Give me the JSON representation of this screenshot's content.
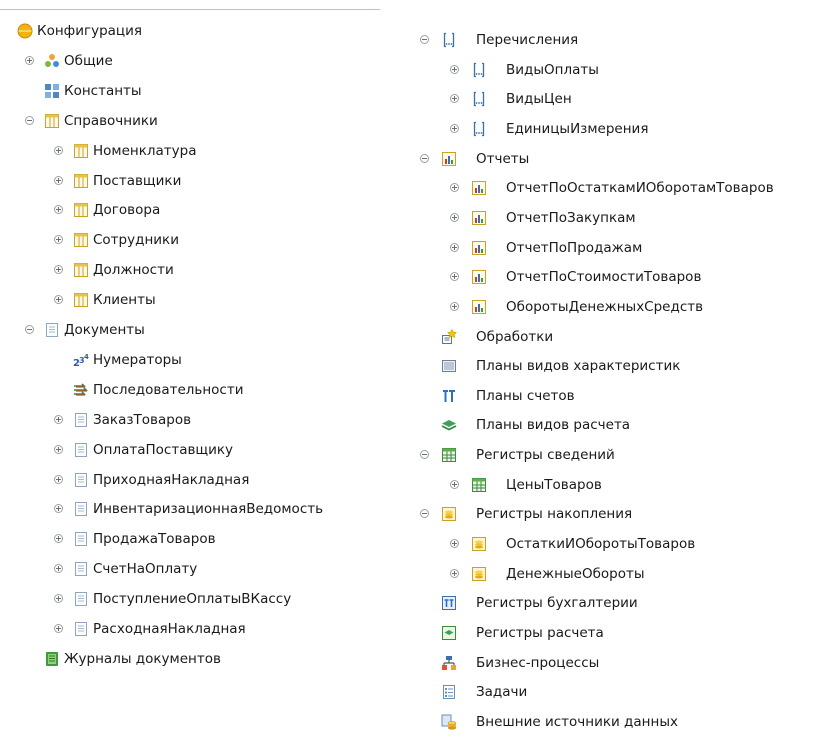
{
  "tree": {
    "left": [
      {
        "label": "Конфигурация",
        "icon": "configuration-icon",
        "toggle": "none",
        "level": 0
      },
      {
        "label": "Общие",
        "icon": "common-icon",
        "toggle": "plus",
        "level": 0
      },
      {
        "label": "Константы",
        "icon": "constants-icon",
        "toggle": "none",
        "level": 0
      },
      {
        "label": "Справочники",
        "icon": "catalog-icon",
        "toggle": "minus",
        "level": 0
      },
      {
        "label": "Номенклатура",
        "icon": "catalog-icon",
        "toggle": "plus",
        "level": 1
      },
      {
        "label": "Поставщики",
        "icon": "catalog-icon",
        "toggle": "plus",
        "level": 1
      },
      {
        "label": "Договора",
        "icon": "catalog-icon",
        "toggle": "plus",
        "level": 1
      },
      {
        "label": "Сотрудники",
        "icon": "catalog-icon",
        "toggle": "plus",
        "level": 1
      },
      {
        "label": "Должности",
        "icon": "catalog-icon",
        "toggle": "plus",
        "level": 1
      },
      {
        "label": "Клиенты",
        "icon": "catalog-icon",
        "toggle": "plus",
        "level": 1
      },
      {
        "label": "Документы",
        "icon": "document-icon",
        "toggle": "minus",
        "level": 0
      },
      {
        "label": "Нумераторы",
        "icon": "numerator-icon",
        "toggle": "none",
        "level": 1
      },
      {
        "label": "Последовательности",
        "icon": "sequence-icon",
        "toggle": "none",
        "level": 1
      },
      {
        "label": "ЗаказТоваров",
        "icon": "document-icon",
        "toggle": "plus",
        "level": 1
      },
      {
        "label": "ОплатаПоставщику",
        "icon": "document-icon",
        "toggle": "plus",
        "level": 1
      },
      {
        "label": "ПриходнаяНакладная",
        "icon": "document-icon",
        "toggle": "plus",
        "level": 1
      },
      {
        "label": "ИнвентаризационнаяВедомость",
        "icon": "document-icon",
        "toggle": "plus",
        "level": 1
      },
      {
        "label": "ПродажаТоваров",
        "icon": "document-icon",
        "toggle": "plus",
        "level": 1
      },
      {
        "label": "СчетНаОплату",
        "icon": "document-icon",
        "toggle": "plus",
        "level": 1
      },
      {
        "label": "ПоступлениеОплатыВКассу",
        "icon": "document-icon",
        "toggle": "plus",
        "level": 1
      },
      {
        "label": "РасходнаяНакладная",
        "icon": "document-icon",
        "toggle": "plus",
        "level": 1
      },
      {
        "label": "Журналы документов",
        "icon": "journal-icon",
        "toggle": "none",
        "level": 0
      }
    ],
    "right": [
      {
        "label": "Перечисления",
        "icon": "enum-icon",
        "toggle": "minus",
        "level": 0
      },
      {
        "label": "ВидыОплаты",
        "icon": "enum-icon",
        "toggle": "plus",
        "level": 1
      },
      {
        "label": "ВидыЦен",
        "icon": "enum-icon",
        "toggle": "plus",
        "level": 1
      },
      {
        "label": "ЕдиницыИзмерения",
        "icon": "enum-icon",
        "toggle": "plus",
        "level": 1
      },
      {
        "label": "Отчеты",
        "icon": "report-icon",
        "toggle": "minus",
        "level": 0
      },
      {
        "label": "ОтчетПоОстаткамИОборотамТоваров",
        "icon": "report-icon",
        "toggle": "plus",
        "level": 1
      },
      {
        "label": "ОтчетПоЗакупкам",
        "icon": "report-icon",
        "toggle": "plus",
        "level": 1
      },
      {
        "label": "ОтчетПоПродажам",
        "icon": "report-icon",
        "toggle": "plus",
        "level": 1
      },
      {
        "label": "ОтчетПоСтоимостиТоваров",
        "icon": "report-icon",
        "toggle": "plus",
        "level": 1
      },
      {
        "label": "ОборотыДенежныхСредств",
        "icon": "report-icon",
        "toggle": "plus",
        "level": 1
      },
      {
        "label": "Обработки",
        "icon": "dataprocessor-icon",
        "toggle": "none",
        "level": 0
      },
      {
        "label": "Планы видов характеристик",
        "icon": "chart-of-characteristics-icon",
        "toggle": "none",
        "level": 0
      },
      {
        "label": "Планы счетов",
        "icon": "chart-of-accounts-icon",
        "toggle": "none",
        "level": 0
      },
      {
        "label": "Планы видов расчета",
        "icon": "chart-of-calculation-icon",
        "toggle": "none",
        "level": 0
      },
      {
        "label": "Регистры сведений",
        "icon": "info-register-icon",
        "toggle": "minus",
        "level": 0
      },
      {
        "label": "ЦеныТоваров",
        "icon": "info-register-icon",
        "toggle": "plus",
        "level": 1
      },
      {
        "label": "Регистры накопления",
        "icon": "accumulation-register-icon",
        "toggle": "minus",
        "level": 0
      },
      {
        "label": "ОстаткиИОборотыТоваров",
        "icon": "accumulation-register-icon",
        "toggle": "plus",
        "level": 1
      },
      {
        "label": "ДенежныеОбороты",
        "icon": "accumulation-register-icon",
        "toggle": "plus",
        "level": 1
      },
      {
        "label": "Регистры бухгалтерии",
        "icon": "accounting-register-icon",
        "toggle": "none",
        "level": 0
      },
      {
        "label": "Регистры расчета",
        "icon": "calculation-register-icon",
        "toggle": "none",
        "level": 0
      },
      {
        "label": "Бизнес-процессы",
        "icon": "business-process-icon",
        "toggle": "none",
        "level": 0
      },
      {
        "label": "Задачи",
        "icon": "task-icon",
        "toggle": "none",
        "level": 0
      },
      {
        "label": "Внешние источники данных",
        "icon": "external-datasource-icon",
        "toggle": "none",
        "level": 0
      }
    ]
  }
}
